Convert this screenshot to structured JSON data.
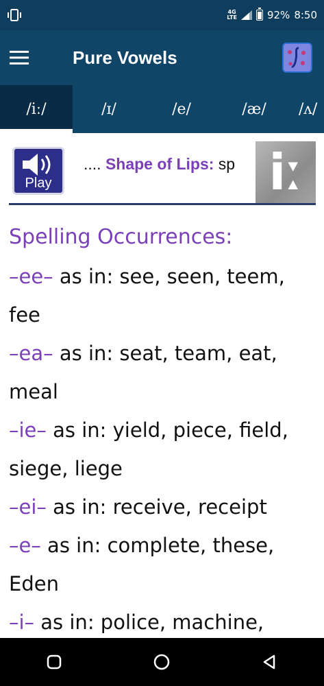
{
  "status_bar": {
    "network_type": "4G",
    "network_sub": "LTE",
    "battery": "92%",
    "battery_level": 0.92,
    "time": "8:50"
  },
  "app_bar": {
    "title": "Pure Vowels",
    "logo_icon": "ipa-logo-icon"
  },
  "tabs": [
    {
      "label": "/iː/",
      "active": true
    },
    {
      "label": "/ɪ/",
      "active": false
    },
    {
      "label": "/e/",
      "active": false
    },
    {
      "label": "/æ/",
      "active": false
    },
    {
      "label": "/ʌ/",
      "active": false
    }
  ],
  "lips_row": {
    "play_label": "Play",
    "prefix": "....",
    "label": "Shape of Lips:",
    "value": "sp",
    "symbol": "iː"
  },
  "content": {
    "heading": "Spelling Occurrences:",
    "occurrences": [
      {
        "pattern": "–ee–",
        "text": " as in: see, seen, teem, fee"
      },
      {
        "pattern": "–ea–",
        "text": " as in: seat, team, eat, meal"
      },
      {
        "pattern": "–ie–",
        "text": " as in: yield, piece, field, siege, liege"
      },
      {
        "pattern": "–ei–",
        "text": " as in: receive, receipt"
      },
      {
        "pattern": "–e–",
        "text": " as in: complete, these, Eden"
      },
      {
        "pattern": "–i–",
        "text": " as in: police, machine,"
      }
    ]
  },
  "colors": {
    "app_bar": "#104567",
    "tab_active": "#0a2b45",
    "accent_purple": "#7b3fb8"
  }
}
